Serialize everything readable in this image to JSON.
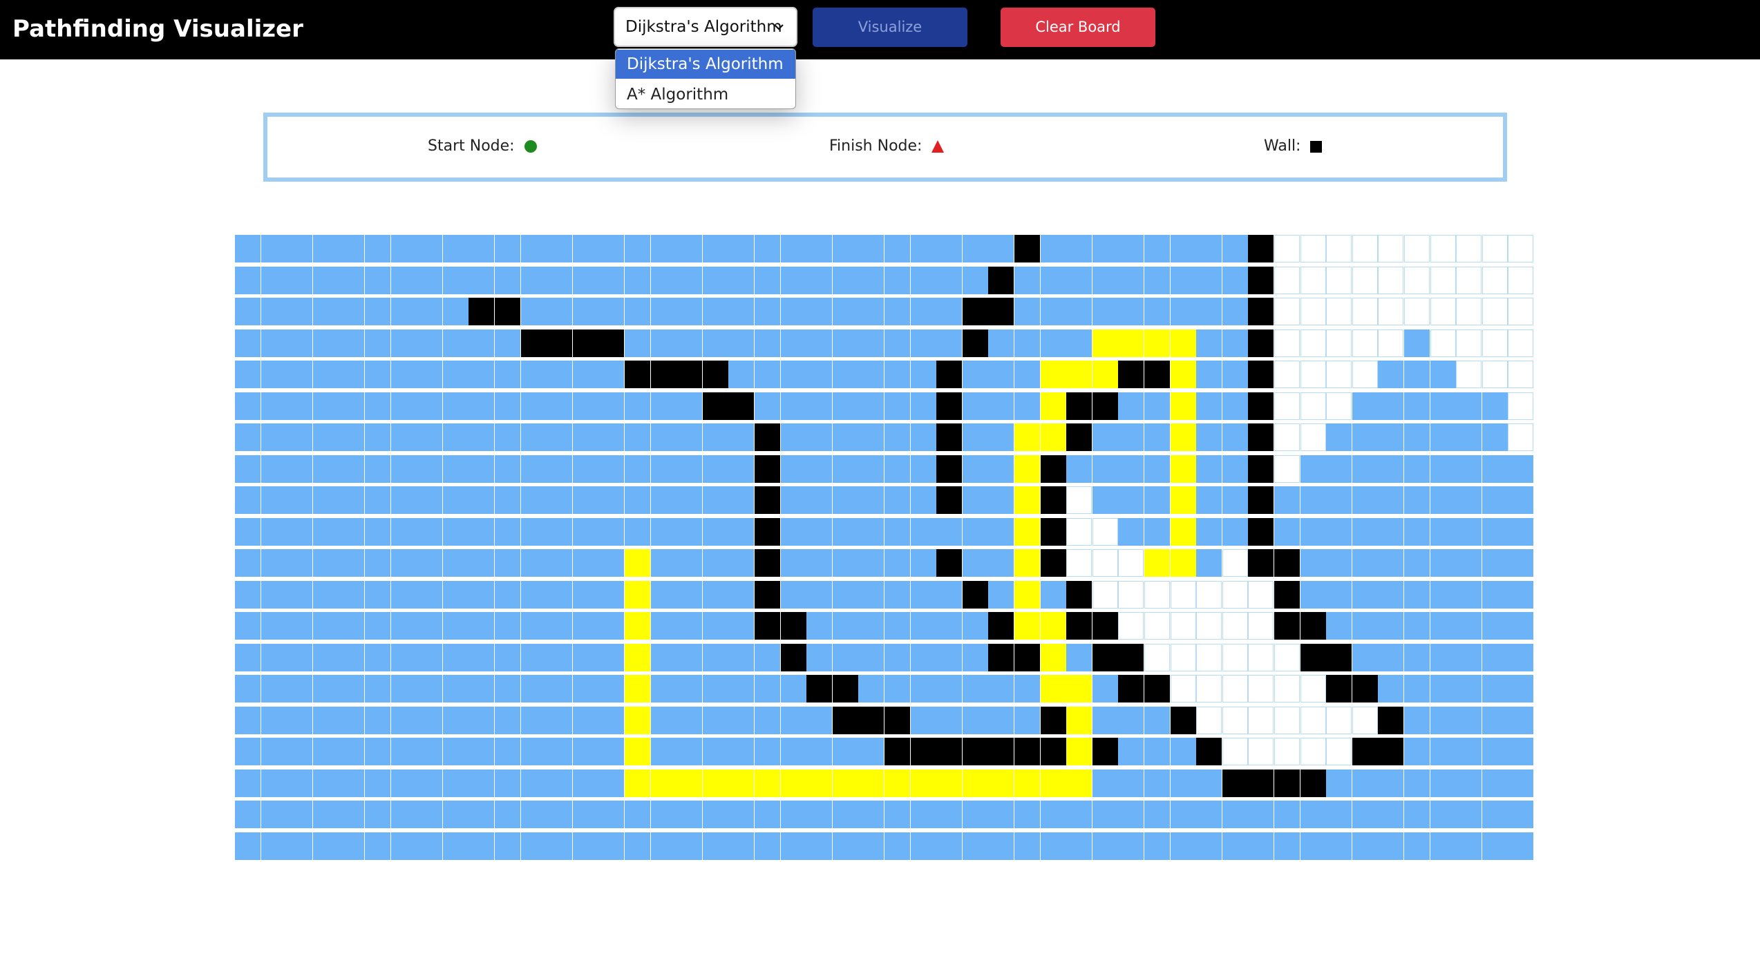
{
  "app": {
    "title": "Pathfinding Visualizer"
  },
  "toolbar": {
    "algorithm_select": {
      "selected": "Dijkstra's Algorithm",
      "options": [
        "Dijkstra's Algorithm",
        "A* Algorithm"
      ],
      "expanded": true
    },
    "visualize_label": "Visualize",
    "clear_label": "Clear Board"
  },
  "legend": {
    "start_label": "Start Node:",
    "finish_label": "Finish Node:",
    "wall_label": "Wall:"
  },
  "colors": {
    "navbar": "#000000",
    "visualize_button": "#1f3a93",
    "clear_button": "#dc3545",
    "visited": "#6cb4f7",
    "unvisited": "#ffffff",
    "wall": "#000000",
    "path": "#ffff00",
    "start": "#1f8a1f",
    "finish": "#e02020",
    "legend_border": "#9fcdf4"
  },
  "grid": {
    "rows": 20,
    "cols": 50,
    "cell_codes": {
      "v": "visited",
      "u": "unvisited",
      "w": "wall",
      "p": "path"
    },
    "cells": [
      "vvvvvvvvvvvvvvvvvvvvvvvvvvvvvvwvvvvvvvvwuuuuuuuuuu",
      "vvvvvvvvvvvvvvvvvvvvvvvvvvvvvwvvvvvvvvvwuuuuuuuuuu",
      "vvvvvvvvvwwvvvvvvvvvvvvvvvvvwwvvvvvvvvvwuuuuuuuuuu",
      "vvvvvvvvvvvwwwwvvvvvvvvvvvvvwvvvvppppvvwuuuuuvuuuu",
      "vvvvvvvvvvvvvvvwwwwvvvvvvvvwvvvpppwwpvvwuuuuvvvuuu",
      "vvvvvvvvvvvvvvvvvvwwvvvvvvvwvvvpwwvvpvvwuuuvvvvvvu",
      "vvvvvvvvvvvvvvvvvvvvwvvvvvvwvvppwvvvpvvwuuvvvvvvvu",
      "vvvvvvvvvvvvvvvvvvvvwvvvvvvwvvpwvvvvpvvwuvvvvvvvvv",
      "vvvvvvvvvvvvvvvvvvvvwvvvvvvwvvpwuvvvpvvwvvvvvvvvvv",
      "vvvvvvvvvvvvvvvvvvvvwvvvvvvvvvpwuuvvpvvwvvvvvvvvvv",
      "vvvvvvvvvvvvvvvpvvvvwvvvvvvwvvpwuuuppvuwwvvvvvvvvv",
      "vvvvvvvvvvvvvvvpvvvvwvvvvvvvwvpvwuuuuuuuwvvvvvvvvv",
      "vvvvvvvvvvvvvvvpvvvvwwvvvvvvvwppwwuuuuuuwwvvvvvvvv",
      "vvvvvvvvvvvvvvvpvvvvvwvvvvvvvwwpvwwuuuuuuwwvvvvvvv",
      "vvvvvvvvvvvvvvvpvvvvvvwwvvvvvvvppvwwuuuuuuwwvvvvvv",
      "vvvvvvvvvvvvvvvpvvvvvvvwwwvvvvvwpvvvwuuuuuuuwvvvvv",
      "vvvvvvvvvvvvvvvpvvvvvvvvvwwwwwwwpwvvvwuuuuuwwvvvvv",
      "vvvvvvvvvvvvvvvppppppppppppppppppvvvvvwwwwvvvvvvvv",
      "vvvvvvvvvvvvvvvvvvvvvvvvvvvvvvvvvvvvvvvvvvvvvvvvvv",
      "vvvvvvvvvvvvvvvvvvvvvvvvvvvvvvvvvvvvvvvvvvvvvvvvvv"
    ]
  }
}
